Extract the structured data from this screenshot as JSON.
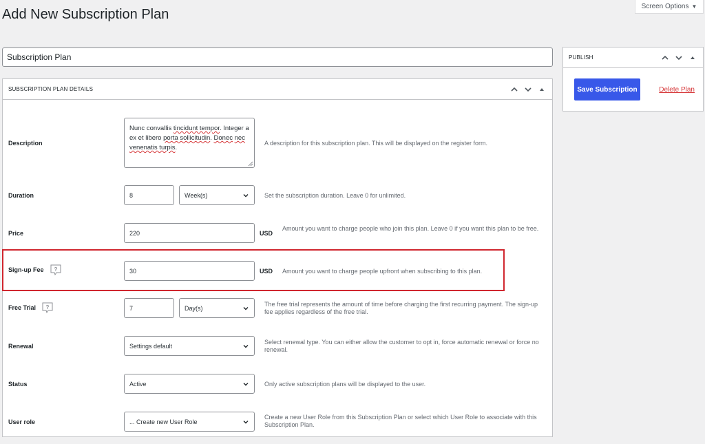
{
  "page": {
    "title": "Add New Subscription Plan",
    "screen_options": "Screen Options"
  },
  "title_input": {
    "value": "Subscription Plan"
  },
  "details": {
    "box_title": "SUBSCRIPTION PLAN DETAILS",
    "description": {
      "label": "Description",
      "value_parts": [
        "Nunc convallis ",
        "tincidunt tempor",
        ". Integer a ex et libero ",
        "porta sollicitudin",
        ". ",
        "Donec",
        " ",
        "nec venenatis turpis",
        "."
      ],
      "help": "A description for this subscription plan. This will be displayed on the register form."
    },
    "duration": {
      "label": "Duration",
      "value": "8",
      "unit": "Week(s)",
      "help": "Set the subscription duration. Leave 0 for unlimited."
    },
    "price": {
      "label": "Price",
      "value": "220",
      "currency": "USD",
      "help": "Amount you want to charge people who join this plan. Leave 0 if you want this plan to be free."
    },
    "signup_fee": {
      "label": "Sign-up Fee",
      "value": "30",
      "currency": "USD",
      "help": "Amount you want to charge people upfront when subscribing to this plan."
    },
    "free_trial": {
      "label": "Free Trial",
      "value": "7",
      "unit": "Day(s)",
      "help": "The free trial represents the amount of time before charging the first recurring payment. The sign-up fee applies regardless of the free trial."
    },
    "renewal": {
      "label": "Renewal",
      "value": "Settings default",
      "help": "Select renewal type. You can either allow the customer to opt in, force automatic renewal or force no renewal."
    },
    "status": {
      "label": "Status",
      "value": "Active",
      "help": "Only active subscription plans will be displayed to the user."
    },
    "user_role": {
      "label": "User role",
      "value": "... Create new User Role",
      "help": "Create a new User Role from this Subscription Plan or select which User Role to associate with this Subscription Plan."
    }
  },
  "publish": {
    "box_title": "PUBLISH",
    "save_label": "Save Subscription",
    "delete_label": "Delete Plan"
  },
  "colors": {
    "primary": "#3858e9",
    "delete": "#d63638",
    "highlight": "#d0262e"
  }
}
